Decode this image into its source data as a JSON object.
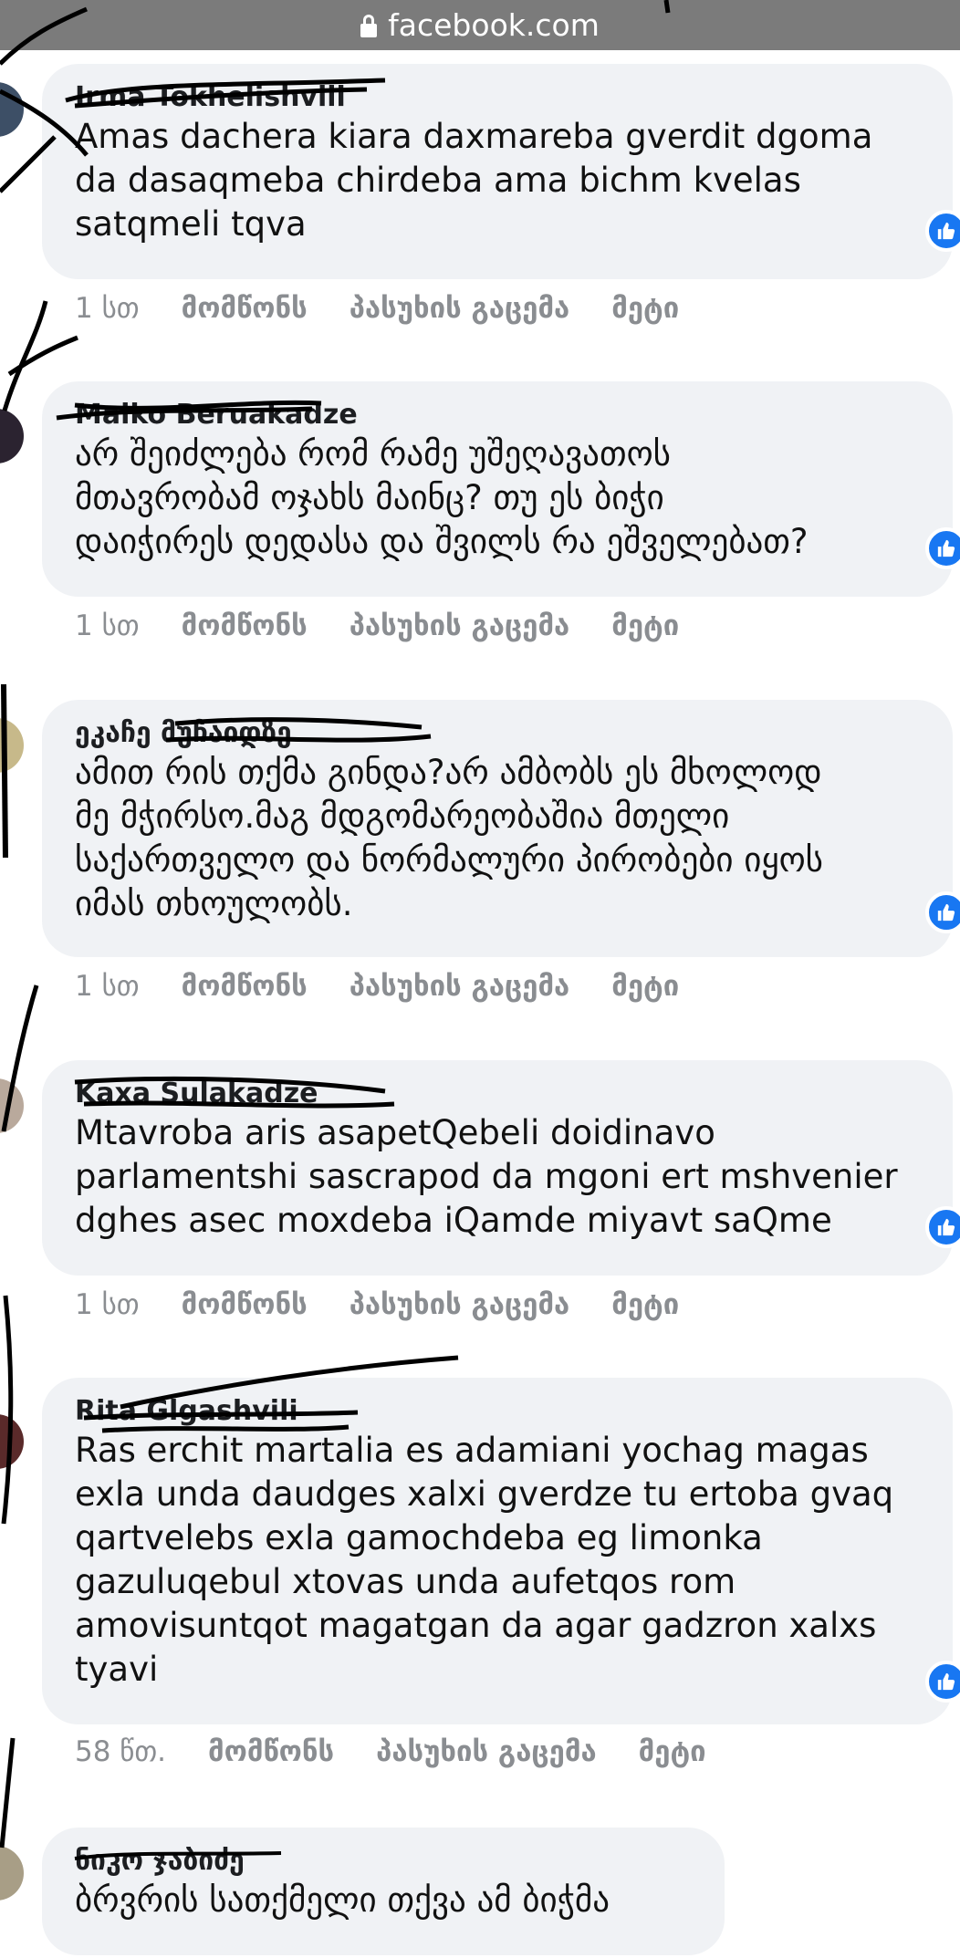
{
  "browser": {
    "url": "facebook.com"
  },
  "comments": [
    {
      "author": "Irma Tokhelishvili",
      "text": "Amas dachera kiara daxmareba gverdit dgoma\nda dasaqmeba chirdeba ama bichm kvelas\nsatqmeli tqva",
      "time": "1 სთ",
      "like": "მომწონს",
      "reply": "პასუხის გაცემა",
      "more": "მეტი"
    },
    {
      "author": "Maiko Beruakadze",
      "text": "არ შეიძლება რომ რამე უშეღავათოს\nმთავრობამ ოჯახს მაინც? თუ ეს ბიჭი\nდაიჭირეს დედასა და შვილს რა ეშველებათ?",
      "time": "1 სთ",
      "like": "მომწონს",
      "reply": "პასუხის გაცემა",
      "more": "მეტი"
    },
    {
      "author": "ეკაჩე მუჩაიდზე",
      "text": "ამით რის თქმა გინდა?არ ამბობს ეს მხოლოდ\nმე მჭირსო.მაგ მდგომარეობაშია მთელი\nსაქართველო და ნორმალური პირობები იყოს\nიმას თხოულობს.",
      "time": "1 სთ",
      "like": "მომწონს",
      "reply": "პასუხის გაცემა",
      "more": "მეტი"
    },
    {
      "author": "Kaxa Sulakadze",
      "text": "Mtavroba aris asapetQebeli doidinavo\nparlamentshi sascrapod da mgoni ert mshvenier\ndghes asec moxdeba iQamde miyavt saQme",
      "time": "1 სთ",
      "like": "მომწონს",
      "reply": "პასუხის გაცემა",
      "more": "მეტი"
    },
    {
      "author": "Rita Glgashvili",
      "text": "Ras erchit martalia es adamiani yochag magas\nexla unda daudges xalxi gverdze tu ertoba gvaq\nqartvelebs exla gamochdeba eg limonka\ngazuluqebul xtovas unda aufetqos rom\namovisuntqot magatgan da agar gadzron xalxs\ntyavi",
      "time": "58 წთ.",
      "like": "მომწონს",
      "reply": "პასუხის გაცემა",
      "more": "მეტი"
    },
    {
      "author": "ნიკო ჯაბიძე",
      "text": "ბრვრის სათქმელი თქვა ამ ბიჭმა"
    }
  ],
  "icons": {
    "lock": "lock-icon",
    "like": "thumbs-up-icon"
  },
  "colors": {
    "bubble": "#f0f2f5",
    "like_badge": "#1877f2",
    "meta_text": "#8a8d91",
    "url_bar": "#7b7b7b"
  }
}
